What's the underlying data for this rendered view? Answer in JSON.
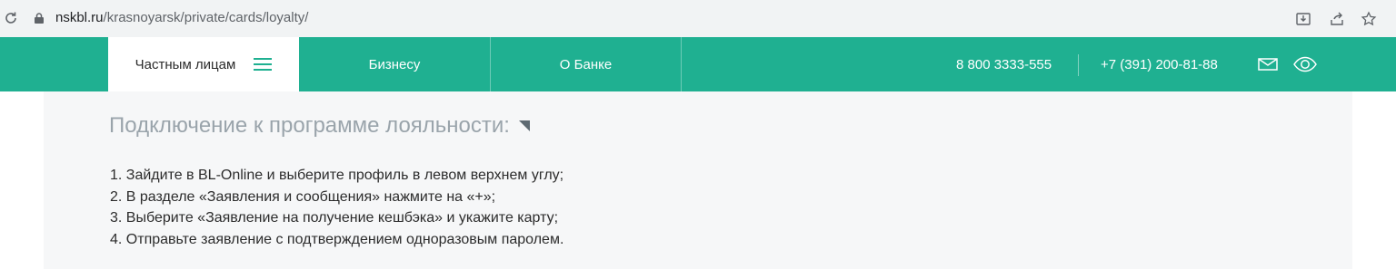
{
  "browser": {
    "url_host": "nskbl.ru",
    "url_path": "/krasnoyarsk/private/cards/loyalty/",
    "icons": [
      "reload-icon",
      "lock-icon",
      "install-icon",
      "share-icon",
      "bookmark-star-icon"
    ]
  },
  "nav": {
    "tabs": [
      {
        "label": "Частным лицам",
        "active": true
      },
      {
        "label": "Бизнесу",
        "active": false
      },
      {
        "label": "О Банке",
        "active": false
      }
    ],
    "phone_free": "8 800 3333-555",
    "phone_local": "+7 (391) 200-81-88",
    "icons": [
      "menu-icon",
      "mail-icon",
      "visually-impaired-eye-icon"
    ]
  },
  "content": {
    "heading": "Подключение к программе лояльности:",
    "steps": [
      "1. Зайдите в BL-Online и выберите профиль в левом верхнем углу;",
      "2. В разделе «Заявления и сообщения» нажмите на «+»;",
      "3. Выберите «Заявление на получение кешбэка» и укажите карту;",
      "4. Отправьте заявление с подтверждением одноразовым паролем."
    ]
  },
  "colors": {
    "brand_green": "#1fb091",
    "heading_gray": "#9aa4ab",
    "panel_bg": "#f6f7f8"
  }
}
